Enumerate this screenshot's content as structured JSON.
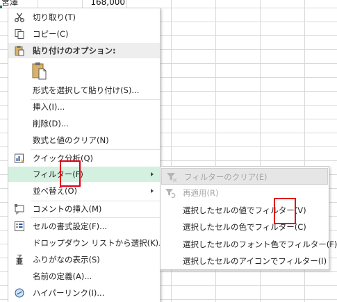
{
  "sheet": {
    "cell_a": "宮澤",
    "cell_b": "168,000"
  },
  "menu": {
    "cut": "切り取り(T)",
    "copy": "コピー(C)",
    "paste_options": "貼り付けのオプション:",
    "paste_special": "形式を選択して貼り付け(S)...",
    "insert": "挿入(I)...",
    "delete": "削除(D)...",
    "clear": "数式と値のクリア(N)",
    "quick_analysis": "クイック分析(Q)",
    "filter": "フィルター(F)",
    "sort": "並べ替え(O)",
    "insert_comment": "コメントの挿入(M)",
    "format_cells": "セルの書式設定(F)...",
    "dropdown": "ドロップダウン リストから選択(K)...",
    "phonetic": "ふりがなの表示(S)",
    "define_name": "名前の定義(A)...",
    "hyperlink": "ハイパーリンク(I)..."
  },
  "submenu": {
    "clear_filter": "フィルターのクリア(E)",
    "reapply": "再適用(R)",
    "by_value": "選択したセルの値でフィルター(V)",
    "by_color": "選択したセルの色でフィルター(C)",
    "by_font_color": "選択したセルのフォント色でフィルター(F)",
    "by_icon": "選択したセルのアイコンでフィルター(I)"
  },
  "colors": {
    "highlight": "#d3f0e0",
    "annotation": "#e00010",
    "excel_green": "#217346"
  }
}
